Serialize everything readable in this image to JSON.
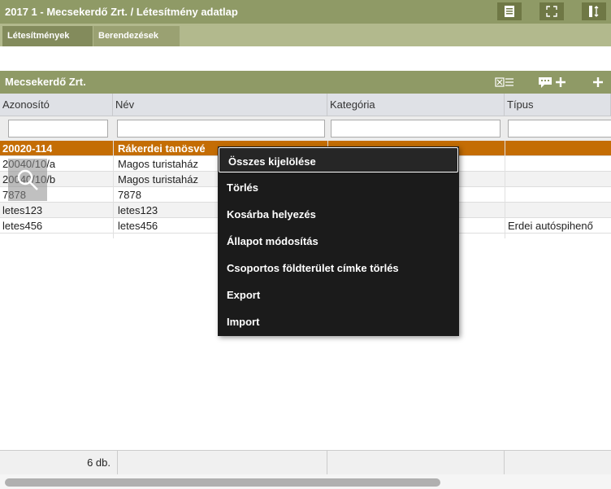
{
  "window": {
    "title": "2017 1 - Mecsekerdő Zrt. / Létesítmény adatlap"
  },
  "tabs": [
    {
      "label": "Létesítmények",
      "active": true
    },
    {
      "label": "Berendezések",
      "active": false
    }
  ],
  "panel": {
    "title": "Mecsekerdő Zrt."
  },
  "grid": {
    "columns": [
      "Azonosító",
      "Név",
      "Kategória",
      "Típus"
    ],
    "rows": [
      {
        "id": "20020-114",
        "name": "Rákerdei tanösvé",
        "category": "",
        "type": "",
        "selected": true
      },
      {
        "id": "20040/10/a",
        "name": "Magos turistaház",
        "category": "",
        "type": ""
      },
      {
        "id": "20040/10/b",
        "name": "Magos turistaház",
        "category": "",
        "type": ""
      },
      {
        "id": "7878",
        "name": "7878",
        "category": "",
        "type": ""
      },
      {
        "id": "letes123",
        "name": "letes123",
        "category": "",
        "type": ""
      },
      {
        "id": "letes456",
        "name": "letes456",
        "category": "",
        "type": "Erdei autóspihenő"
      }
    ],
    "count_label": "6 db."
  },
  "context_menu": {
    "items": [
      "Összes kijelölése",
      "Törlés",
      "Kosárba helyezés",
      "Állapot módosítás",
      "Csoportos földterület címke törlés",
      "Export",
      "Import"
    ]
  },
  "colors": {
    "header_bg": "#8f9a66",
    "tab_active": "#838b5c",
    "selected_row": "#c46d04",
    "menu_bg": "#1b1b1b"
  },
  "icons": [
    "document-icon",
    "fullscreen-icon",
    "split-icon",
    "table-export-icon",
    "add-comment-icon",
    "add-icon",
    "search-icon"
  ]
}
